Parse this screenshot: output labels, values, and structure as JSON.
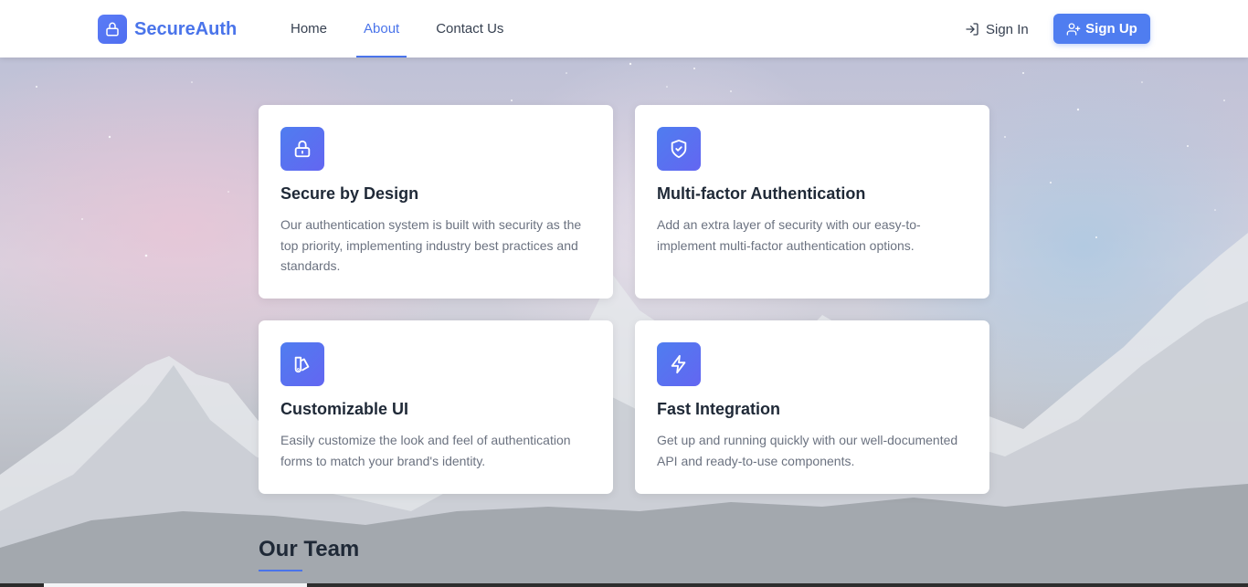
{
  "brand": {
    "name": "SecureAuth",
    "icon": "lock-icon",
    "color": "#4a74ea"
  },
  "nav": {
    "items": [
      {
        "label": "Home",
        "active": false
      },
      {
        "label": "About",
        "active": true
      },
      {
        "label": "Contact Us",
        "active": false
      }
    ]
  },
  "auth": {
    "sign_in_label": "Sign In",
    "sign_in_icon": "login-arrow-icon",
    "sign_up_label": "Sign Up",
    "sign_up_icon": "user-plus-icon"
  },
  "features": [
    {
      "icon": "lock-icon",
      "title": "Secure by Design",
      "description": "Our authentication system is built with security as the top priority, implementing industry best practices and standards."
    },
    {
      "icon": "shield-check-icon",
      "title": "Multi-factor Authentication",
      "description": "Add an extra layer of security with our easy-to-implement multi-factor authentication options."
    },
    {
      "icon": "palette-swatch-icon",
      "title": "Customizable UI",
      "description": "Easily customize the look and feel of authentication forms to match your brand's identity."
    },
    {
      "icon": "lightning-bolt-icon",
      "title": "Fast Integration",
      "description": "Get up and running quickly with our well-documented API and ready-to-use components."
    }
  ],
  "team": {
    "heading": "Our Team"
  },
  "colors": {
    "accent": "#4f7df0",
    "icon_gradient_end": "#6366f1",
    "text_muted": "#6b7280"
  }
}
